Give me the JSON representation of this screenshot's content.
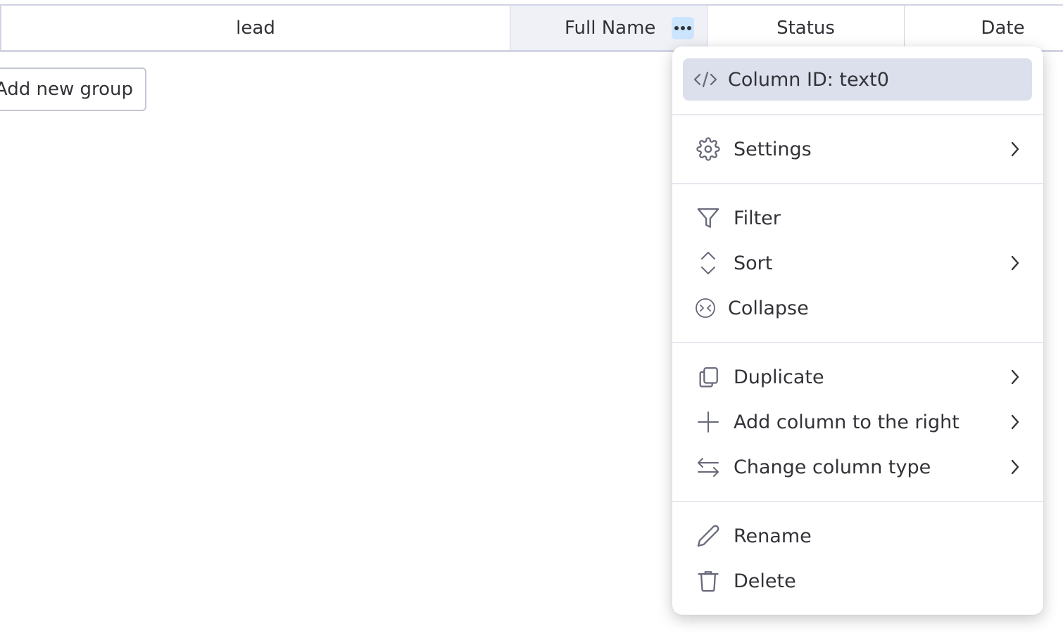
{
  "table": {
    "columns": [
      {
        "label": "lead"
      },
      {
        "label": "Full Name"
      },
      {
        "label": "Status"
      },
      {
        "label": "Date"
      }
    ],
    "add_group_label": "Add new group"
  },
  "menu": {
    "column_id": "Column ID: text0",
    "items": {
      "settings": "Settings",
      "filter": "Filter",
      "sort": "Sort",
      "collapse": "Collapse",
      "duplicate": "Duplicate",
      "add_column_right": "Add column to the right",
      "change_column_type": "Change column type",
      "rename": "Rename",
      "delete": "Delete"
    }
  },
  "colors": {
    "highlight": "#dcdfec",
    "dots_button": "#cce5ff",
    "active_header": "#f0f1f6",
    "border": "#d0d4e4",
    "text": "#323338"
  }
}
